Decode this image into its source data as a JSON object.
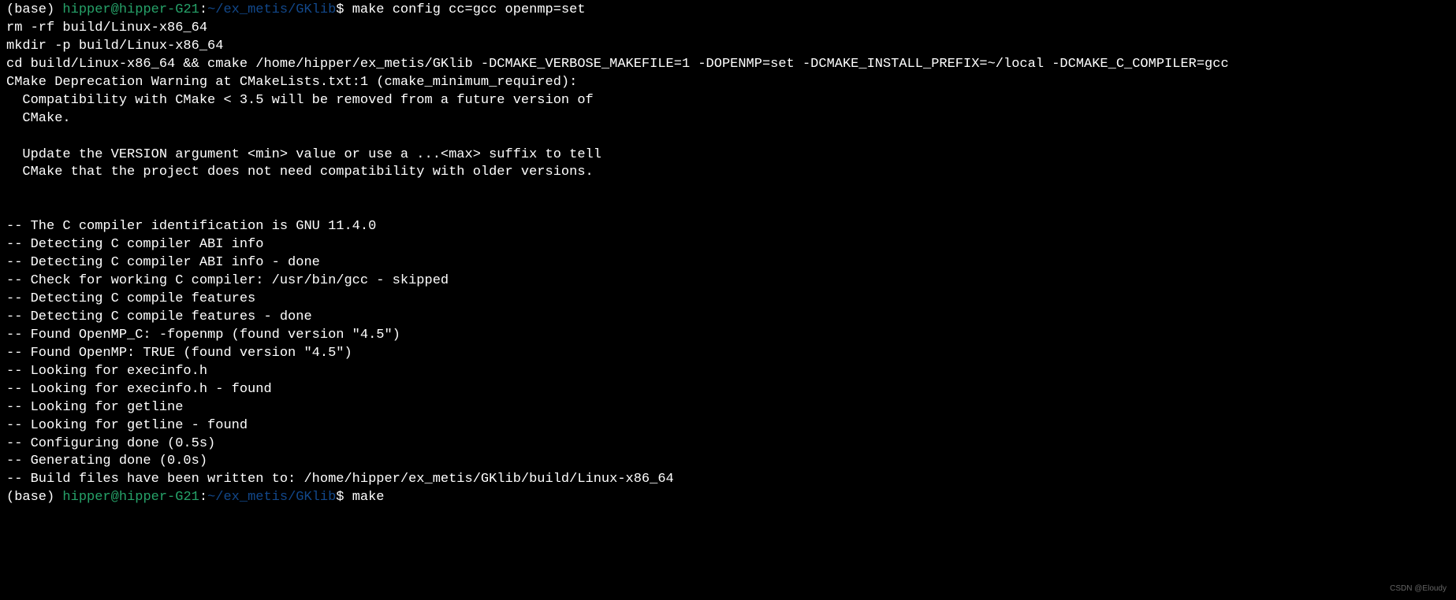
{
  "prompt1": {
    "env": "(base) ",
    "userhost": "hipper@hipper-G21",
    "colon": ":",
    "path": "~/ex_metis/GKlib",
    "dollar": "$ ",
    "command": "make config cc=gcc openmp=set"
  },
  "output_lines": [
    "rm -rf build/Linux-x86_64",
    "mkdir -p build/Linux-x86_64",
    "cd build/Linux-x86_64 && cmake /home/hipper/ex_metis/GKlib -DCMAKE_VERBOSE_MAKEFILE=1 -DOPENMP=set -DCMAKE_INSTALL_PREFIX=~/local -DCMAKE_C_COMPILER=gcc",
    "CMake Deprecation Warning at CMakeLists.txt:1 (cmake_minimum_required):",
    "  Compatibility with CMake < 3.5 will be removed from a future version of",
    "  CMake.",
    "",
    "  Update the VERSION argument <min> value or use a ...<max> suffix to tell",
    "  CMake that the project does not need compatibility with older versions.",
    "",
    "",
    "-- The C compiler identification is GNU 11.4.0",
    "-- Detecting C compiler ABI info",
    "-- Detecting C compiler ABI info - done",
    "-- Check for working C compiler: /usr/bin/gcc - skipped",
    "-- Detecting C compile features",
    "-- Detecting C compile features - done",
    "-- Found OpenMP_C: -fopenmp (found version \"4.5\")",
    "-- Found OpenMP: TRUE (found version \"4.5\")",
    "-- Looking for execinfo.h",
    "-- Looking for execinfo.h - found",
    "-- Looking for getline",
    "-- Looking for getline - found",
    "-- Configuring done (0.5s)",
    "-- Generating done (0.0s)",
    "-- Build files have been written to: /home/hipper/ex_metis/GKlib/build/Linux-x86_64"
  ],
  "prompt2": {
    "env": "(base) ",
    "userhost": "hipper@hipper-G21",
    "colon": ":",
    "path": "~/ex_metis/GKlib",
    "dollar": "$ ",
    "command": "make"
  },
  "watermark": "CSDN @Eloudy"
}
